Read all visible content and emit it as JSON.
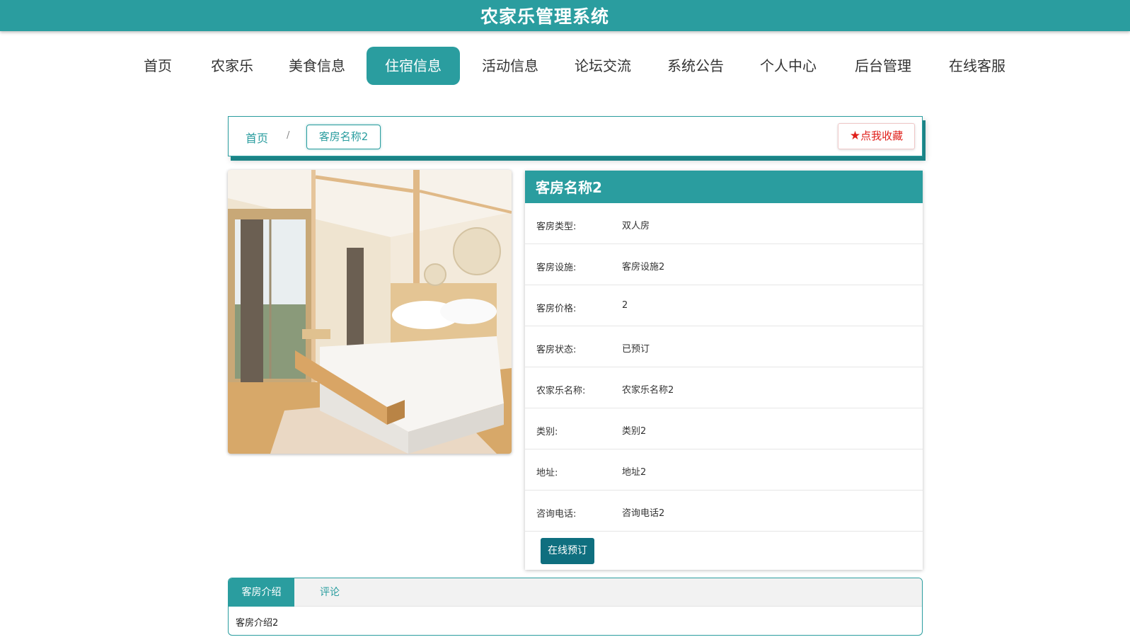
{
  "header": {
    "title": "农家乐管理系统"
  },
  "nav": {
    "items": [
      {
        "label": "首页"
      },
      {
        "label": "农家乐"
      },
      {
        "label": "美食信息"
      },
      {
        "label": "住宿信息"
      },
      {
        "label": "活动信息"
      },
      {
        "label": "论坛交流"
      },
      {
        "label": "系统公告"
      },
      {
        "label": "个人中心"
      },
      {
        "label": "后台管理"
      },
      {
        "label": "在线客服"
      }
    ],
    "active": "住宿信息"
  },
  "breadcrumb": {
    "home": "首页",
    "separator": "/",
    "current": "客房名称2"
  },
  "favorite": {
    "star": "★",
    "label": "点我收藏"
  },
  "detail": {
    "title": "客房名称2",
    "rows": [
      {
        "label": "客房类型:",
        "value": "双人房"
      },
      {
        "label": "客房设施:",
        "value": "客房设施2"
      },
      {
        "label": "客房价格:",
        "value": "2"
      },
      {
        "label": "客房状态:",
        "value": "已预订"
      },
      {
        "label": "农家乐名称:",
        "value": "农家乐名称2"
      },
      {
        "label": "类别:",
        "value": "类别2"
      },
      {
        "label": "地址:",
        "value": "地址2"
      },
      {
        "label": "咨询电话:",
        "value": "咨询电话2"
      }
    ],
    "book_label": "在线预订"
  },
  "tabs": {
    "items": [
      {
        "label": "客房介绍"
      },
      {
        "label": "评论"
      }
    ],
    "content": "客房介绍2"
  },
  "colors": {
    "primary": "#2a9d9f",
    "book_button": "#0f6f7f",
    "favorite": "#e0201b"
  },
  "icons": {
    "favorite": "star-icon"
  }
}
